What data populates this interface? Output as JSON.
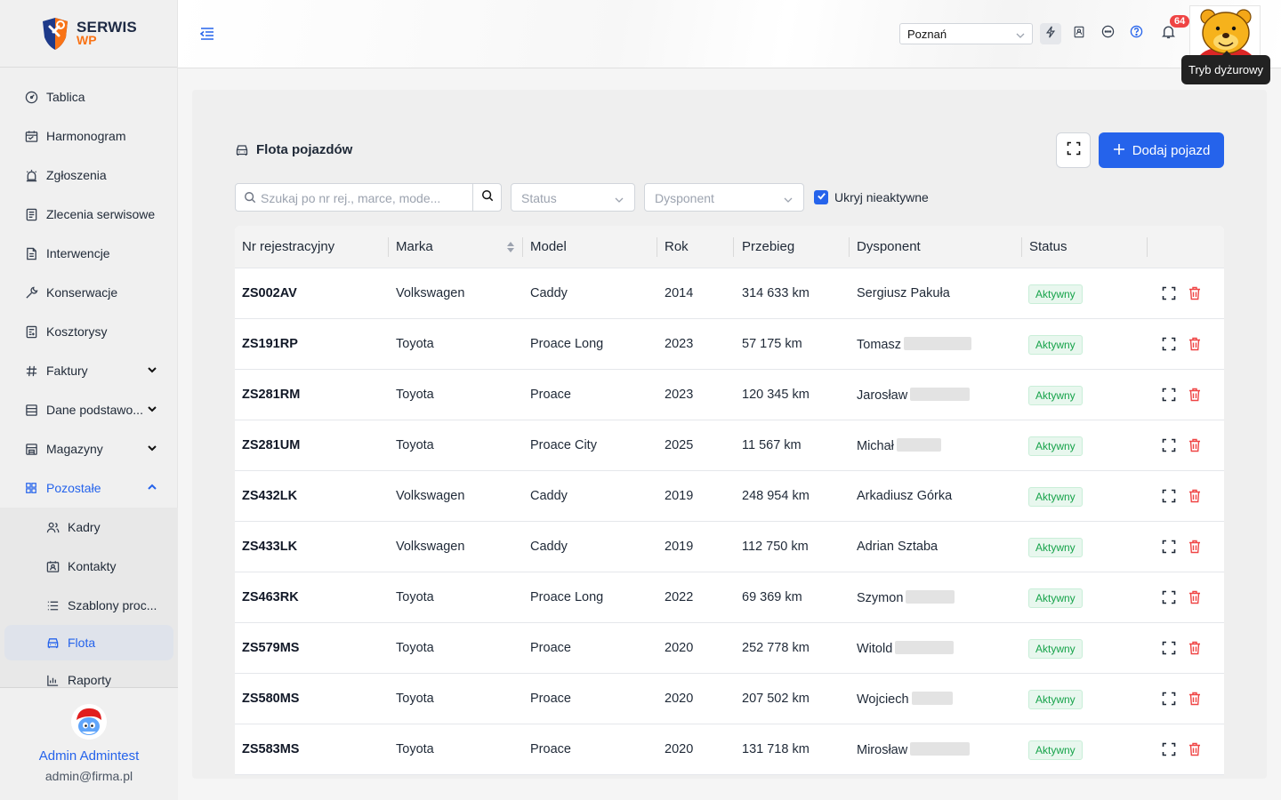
{
  "logo": {
    "line1": "SERWIS",
    "line2": "WP"
  },
  "sidebar": {
    "items": [
      {
        "label": "Tablica",
        "icon": "dashboard-icon"
      },
      {
        "label": "Harmonogram",
        "icon": "calendar-icon"
      },
      {
        "label": "Zgłoszenia",
        "icon": "alarm-icon"
      },
      {
        "label": "Zlecenia serwisowe",
        "icon": "clipboard-icon"
      },
      {
        "label": "Interwencje",
        "icon": "document-icon"
      },
      {
        "label": "Konserwacje",
        "icon": "wrench-icon"
      },
      {
        "label": "Kosztorysy",
        "icon": "calculator-doc-icon"
      },
      {
        "label": "Faktury",
        "icon": "hash-icon"
      },
      {
        "label": "Dane podstawo...",
        "icon": "database-icon"
      },
      {
        "label": "Magazyny",
        "icon": "warehouse-icon"
      },
      {
        "label": "Pozostałe",
        "icon": "grid-icon"
      }
    ],
    "subitems": [
      {
        "label": "Kadry",
        "icon": "users-icon"
      },
      {
        "label": "Kontakty",
        "icon": "contact-card-icon"
      },
      {
        "label": "Szablony proc...",
        "icon": "list-icon"
      },
      {
        "label": "Flota",
        "icon": "car-icon"
      },
      {
        "label": "Raporty",
        "icon": "chart-icon"
      }
    ]
  },
  "user": {
    "name": "Admin Admintest",
    "email": "admin@firma.pl"
  },
  "header": {
    "city": "Poznań",
    "notifications_count": "64",
    "tooltip": "Tryb dyżurowy"
  },
  "panel": {
    "title": "Flota pojazdów",
    "add_button": "Dodaj pojazd",
    "search_placeholder": "Szukaj po nr rej., marce, mode...",
    "status_placeholder": "Status",
    "dispatcher_placeholder": "Dysponent",
    "hide_inactive_label": "Ukryj nieaktywne"
  },
  "table": {
    "columns": [
      "Nr rejestracyjny",
      "Marka",
      "Model",
      "Rok",
      "Przebieg",
      "Dysponent",
      "Status"
    ],
    "rows": [
      {
        "plate": "ZS002AV",
        "brand": "Volkswagen",
        "model": "Caddy",
        "year": "2014",
        "mileage": "314 633 km",
        "dispatcher": "Sergiusz Pakuła",
        "status": "Aktywny"
      },
      {
        "plate": "ZS191RP",
        "brand": "Toyota",
        "model": "Proace Long",
        "year": "2023",
        "mileage": "57 175 km",
        "dispatcher": "Tomasz",
        "status": "Aktywny"
      },
      {
        "plate": "ZS281RM",
        "brand": "Toyota",
        "model": "Proace",
        "year": "2023",
        "mileage": "120 345 km",
        "dispatcher": "Jarosław",
        "status": "Aktywny"
      },
      {
        "plate": "ZS281UM",
        "brand": "Toyota",
        "model": "Proace City",
        "year": "2025",
        "mileage": "11 567 km",
        "dispatcher": "Michał",
        "status": "Aktywny"
      },
      {
        "plate": "ZS432LK",
        "brand": "Volkswagen",
        "model": "Caddy",
        "year": "2019",
        "mileage": "248 954 km",
        "dispatcher": "Arkadiusz Górka",
        "status": "Aktywny"
      },
      {
        "plate": "ZS433LK",
        "brand": "Volkswagen",
        "model": "Caddy",
        "year": "2019",
        "mileage": "112 750 km",
        "dispatcher": "Adrian Sztaba",
        "status": "Aktywny"
      },
      {
        "plate": "ZS463RK",
        "brand": "Toyota",
        "model": "Proace Long",
        "year": "2022",
        "mileage": "69 369 km",
        "dispatcher": "Szymon",
        "status": "Aktywny"
      },
      {
        "plate": "ZS579MS",
        "brand": "Toyota",
        "model": "Proace",
        "year": "2020",
        "mileage": "252 778 km",
        "dispatcher": "Witold",
        "status": "Aktywny"
      },
      {
        "plate": "ZS580MS",
        "brand": "Toyota",
        "model": "Proace",
        "year": "2020",
        "mileage": "207 502 km",
        "dispatcher": "Wojciech",
        "status": "Aktywny"
      },
      {
        "plate": "ZS583MS",
        "brand": "Toyota",
        "model": "Proace",
        "year": "2020",
        "mileage": "131 718 km",
        "dispatcher": "Mirosław",
        "status": "Aktywny"
      }
    ]
  },
  "colors": {
    "accent": "#2563eb",
    "status_active": "#16a34a",
    "danger": "#ef4444"
  }
}
